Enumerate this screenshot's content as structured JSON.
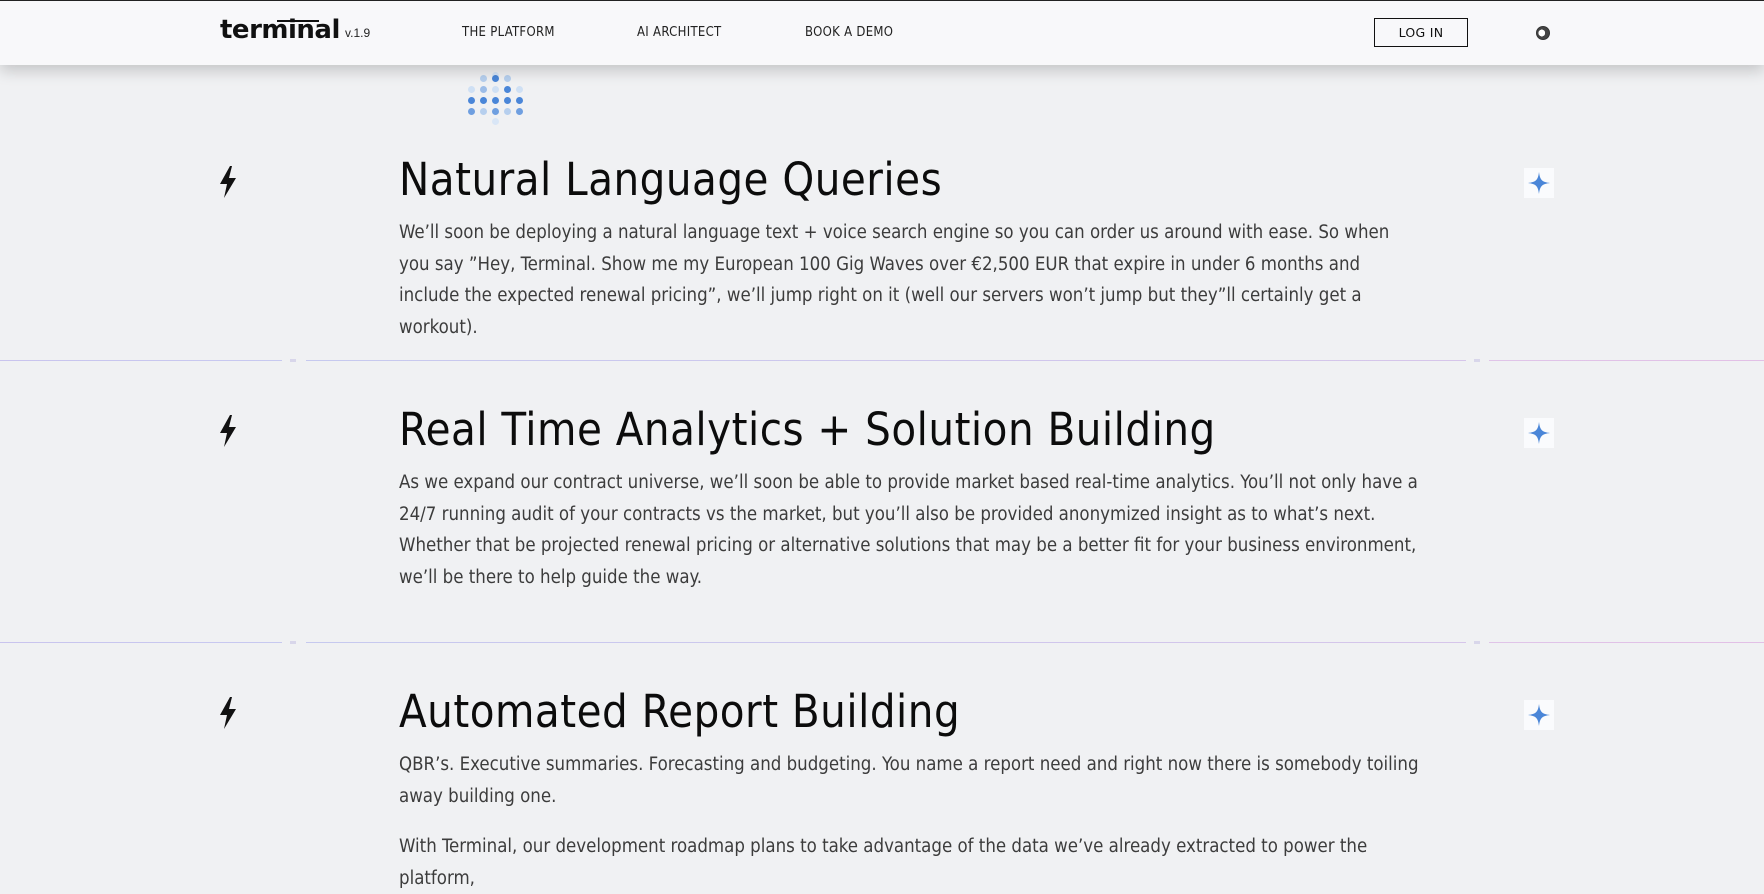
{
  "header": {
    "logo": "terminal",
    "version": "v.1.9",
    "nav": [
      "THE PLATFORM",
      "AI ARCHITECT",
      "BOOK A DEMO"
    ],
    "login_label": "LOG IN"
  },
  "icons": {
    "bolt": "lightning-bolt-icon",
    "sparkle": "sparkle-icon",
    "theme": "theme-toggle-icon"
  },
  "colors": {
    "accent_blue": "#4a86d8",
    "background": "#f0f1f3"
  },
  "sections": [
    {
      "title": "Natural Language Queries",
      "body": "We’ll soon be deploying a natural language text + voice search engine so you can order us around with ease. So when you say ”Hey, Terminal. Show me my European 100 Gig Waves over €2,500 EUR that expire in under 6 months and include the expected renewal pricing”, we’ll jump right on it (well our servers won’t jump but they”ll certainly get a workout)."
    },
    {
      "title": "Real Time Analytics + Solution Building",
      "body": "As we expand our contract universe, we’ll soon be able to provide market based real-time analytics. You’ll not only have a 24/7 running audit of your contracts vs the market, but you’ll also be provided anonymized insight as to what’s next. Whether that be projected renewal pricing or alternative solutions that may be a better fit for your business environment, we’ll be there to help guide the way."
    },
    {
      "title": "Automated Report Building",
      "body": "QBR’s. Executive summaries. Forecasting and budgeting. You name a report need and right now there is somebody toiling away building one.",
      "body2": "With Terminal, our development roadmap plans to take advantage of the data we’ve already extracted to power the platform,"
    }
  ]
}
